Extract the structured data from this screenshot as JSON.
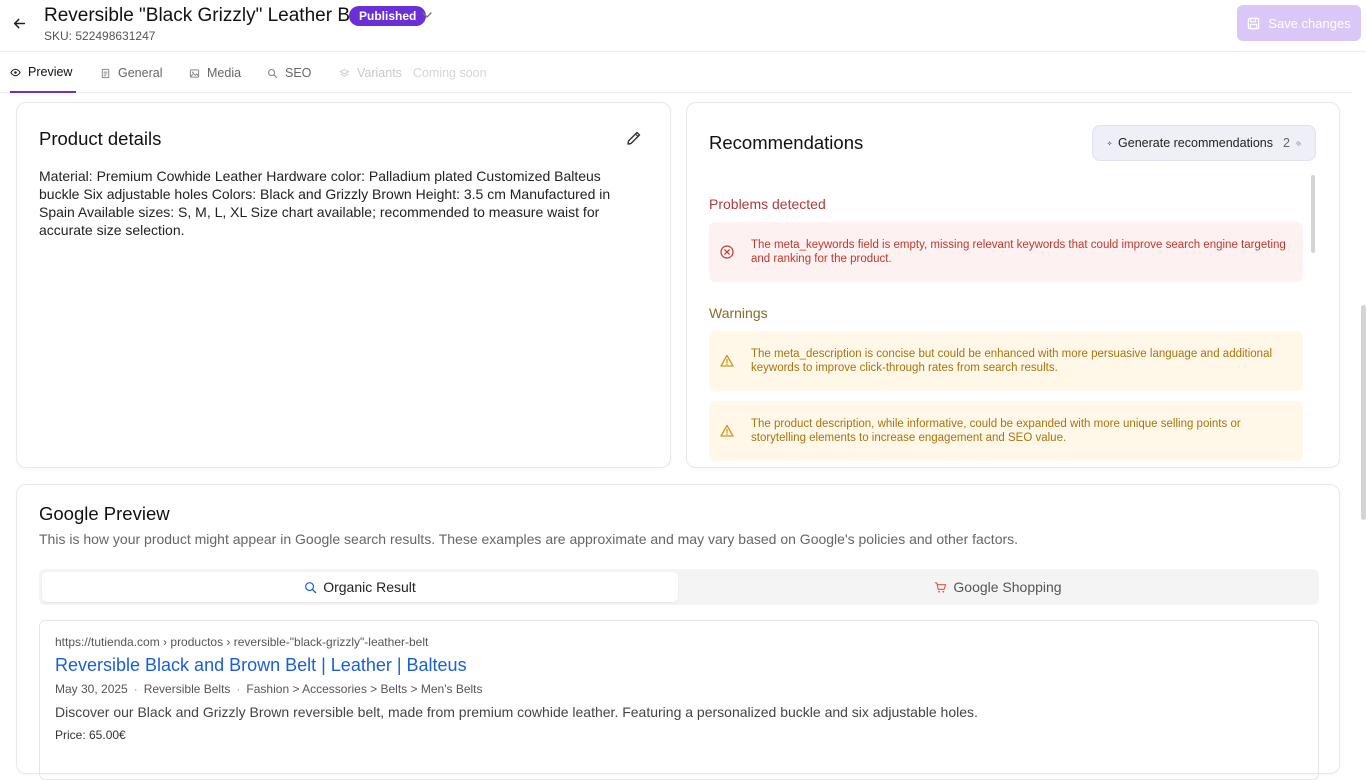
{
  "header": {
    "title": "Reversible \"Black Grizzly\" Leather Belt",
    "status": "Published",
    "sku": "SKU: 522498631247",
    "save_label": "Save changes"
  },
  "tabs": [
    {
      "label": "Preview",
      "icon": "eye-icon"
    },
    {
      "label": "General",
      "icon": "document-icon"
    },
    {
      "label": "Media",
      "icon": "image-icon"
    },
    {
      "label": "SEO",
      "icon": "search-icon"
    },
    {
      "label": "Variants",
      "icon": "layers-icon",
      "badge": "Coming soon"
    }
  ],
  "product": {
    "title": "Product details",
    "description": "Material: Premium Cowhide Leather Hardware color: Palladium plated Customized Balteus buckle Six adjustable holes Colors: Black and Grizzly Brown Height: 3.5 cm Manufactured in Spain Available sizes: S, M, L, XL Size chart available; recommended to measure waist for accurate size selection."
  },
  "recommendations": {
    "title": "Recommendations",
    "generate_label": "Generate recommendations",
    "generate_count": "2",
    "problems_label": "Problems detected",
    "problems": [
      "The meta_keywords field is empty, missing relevant keywords that could improve search engine targeting and ranking for the product."
    ],
    "warnings_label": "Warnings",
    "warnings": [
      "The meta_description is concise but could be enhanced with more persuasive language and additional keywords to improve click-through rates from search results.",
      "The product description, while informative, could be expanded with more unique selling points or storytelling elements to increase engagement and SEO value."
    ]
  },
  "google": {
    "title": "Google Preview",
    "subtitle": "This is how your product might appear in Google search results. These examples are approximate and may vary based on Google's policies and other factors.",
    "tab_organic": "Organic Result",
    "tab_shopping": "Google Shopping",
    "result": {
      "url": "https://tutienda.com › productos › reversible-\"black-grizzly\"-leather-belt",
      "title": "Reversible Black and Brown Belt | Leather | Balteus",
      "date": "May 30, 2025",
      "category": "Reversible Belts",
      "breadcrumb": "Fashion > Accessories > Belts > Men's Belts",
      "description": "Discover our Black and Grizzly Brown reversible belt, made from premium cowhide leather. Featuring a personalized buckle and six adjustable holes.",
      "price": "Price: 65.00€"
    }
  },
  "colors": {
    "accent": "#6b2fd6",
    "error": "#c0392b",
    "warning": "#a8740f",
    "link": "#1a5fd6"
  }
}
